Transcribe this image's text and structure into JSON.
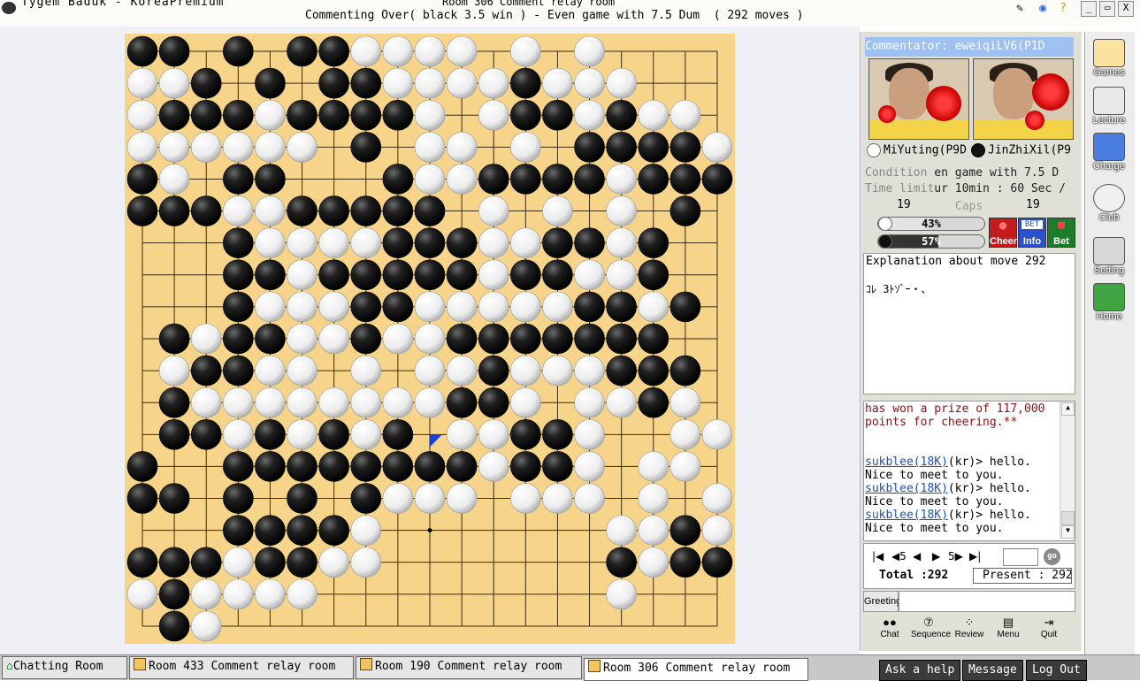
{
  "window": {
    "app_title": "Tygem Baduk - KoreaPremium",
    "room_title": "Room 306 Comment relay room",
    "room_subtitle": "Commenting Over( black 3.5 win ) - Even game with 7.5 Dum  ( 292 moves )",
    "controls": {
      "minimize": "_",
      "maximize": "▭",
      "close": "X"
    }
  },
  "board": {
    "size": 19,
    "last_move": [
      9,
      12
    ],
    "star_point_shown": [
      9,
      15
    ],
    "rows": [
      "BB.B.BBWWWW.W.W....",
      "WWB.B.BBWWWWBWWW...",
      "WBBBWBBBBW.WBBWBWW.",
      "WWWWWW.B.WW.W.BBBBW",
      "BW.BB...BWWBBBBWBBB",
      "BBBWWBBBBB.W.W.W.B.",
      "...BWWWWBBBWWBBWB..",
      "...BBWBBBBBWBBWWB..",
      "...BWWWBBWWWWWBBWB.",
      ".BWBBWWBWWBBBBBBB..",
      ".WBBWW.W.WWBWWWBBB.",
      ".BWWWWWWWWBBW.WWBW.",
      ".BBWBWBWB.WWBBW..WW",
      "B..BBBBBBBBWBBW.WW.",
      "BB.B.B.BWWW.WWW.W.W",
      "...BBBBW.......WWBW.",
      "BBBWBBWW.......BWBBW",
      "WBWWWW.........W..",
      ".BW................"
    ]
  },
  "panel": {
    "commentator": "Commentator: eweiqiLV6(P1D",
    "player_white": "MiYuting(P9D",
    "player_black": "JinZhiXil(P9",
    "condition_label": "Condition",
    "condition_value": "en game with 7.5 D",
    "time_label": "Time limit",
    "time_value": "ur 10min : 60 Sec /",
    "caps_label": "Caps",
    "caps_white": "19",
    "caps_black": "19",
    "cheer_white_percent": 43,
    "cheer_white_label": "43%",
    "cheer_black_percent": 57,
    "cheer_black_label": "57%",
    "buttons": {
      "cheer": "Cheer",
      "info": "Info",
      "bet": "Bet",
      "bet_badge": "BET"
    },
    "explanation_title": "Explanation about move 292",
    "explanation_text": "ｺﾚ 3ﾄｿﾞｰ・、",
    "chat": {
      "system_line1": "has won a prize of 117,000",
      "system_line2": "points for cheering.**",
      "messages": [
        {
          "user": "sukblee(18K)",
          "text": "(kr)> hello.",
          "cont": "Nice to meet to you."
        },
        {
          "user": "sukblee(18K)",
          "text": "(kr)> hello.",
          "cont": "Nice to meet to you."
        },
        {
          "user": "sukblee(18K)",
          "text": "(kr)> hello.",
          "cont": "Nice to meet to you."
        }
      ]
    },
    "nav": {
      "first": "|◀",
      "back5": "◀5",
      "back1": "◀",
      "fwd1": "▶",
      "fwd5": "5▶",
      "last": "▶|",
      "go": "go"
    },
    "total_label": "Total :292",
    "present_label": "Present : 292",
    "greeting_label": "Greeting",
    "tools": [
      "Chat",
      "Sequence",
      "Review",
      "Menu",
      "Quit"
    ],
    "tool_icons": [
      "chat-icon",
      "sequence-icon",
      "review-icon",
      "menu-icon",
      "quit-icon"
    ]
  },
  "sidebar": {
    "items": [
      "Games",
      "Lecture",
      "Charge",
      "Club",
      "Setting",
      "Home"
    ],
    "icons": [
      "games-icon",
      "lecture-icon",
      "charge-icon",
      "club-icon",
      "setting-icon",
      "home-icon"
    ]
  },
  "taskbar": {
    "tabs": [
      "Chatting Room",
      "Room 433 Comment relay room",
      "Room 190 Comment relay room",
      "Room 306 Comment relay room"
    ],
    "active_tab": 3,
    "buttons": [
      "Ask a help",
      "Message",
      "Log Out"
    ]
  },
  "colors": {
    "board": "#f6d58a",
    "panel": "#e1e0d6",
    "commentator_bar": "#9ec0f2",
    "link": "#1f4fb8",
    "system_chat": "#8b1010",
    "last_move_marker": "#1c3fd6"
  }
}
